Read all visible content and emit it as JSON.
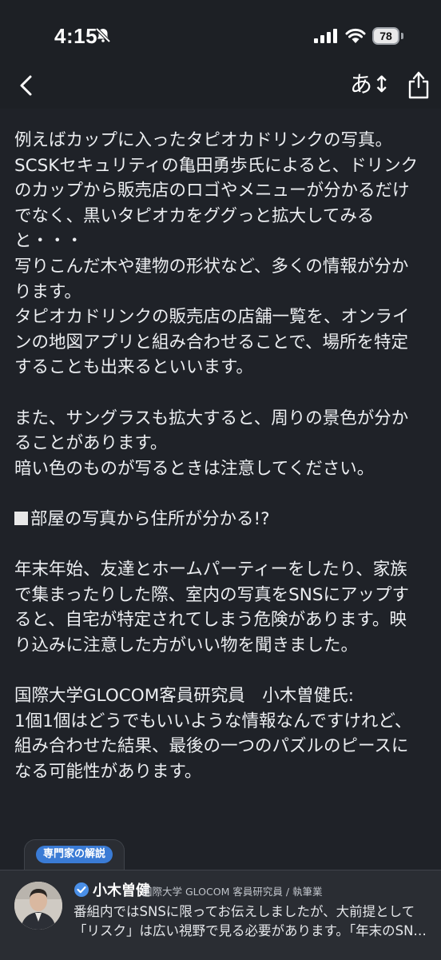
{
  "status_bar": {
    "time": "4:15",
    "battery": "78",
    "icons": [
      "bell-slash-icon",
      "signal-icon",
      "wifi-icon",
      "battery-icon"
    ]
  },
  "nav": {
    "back_icon": "chevron-left-icon",
    "text_size_label": "あ↕",
    "share_icon": "share-icon"
  },
  "article": {
    "lines": [
      "例えばカップに入ったタピオカドリンクの写真。",
      "SCSKセキュリティの亀田勇歩氏によると、ドリンク",
      "のカップから販売店のロゴやメニューが分かるだけ",
      "でなく、黒いタピオカをググっと拡大してみる",
      "と・・・",
      "写りこんだ木や建物の形状など、多くの情報が分か",
      "ります。",
      "タピオカドリンクの販売店の店舗一覧を、オンライ",
      "ンの地図アプリと組み合わせることで、場所を特定",
      "することも出来るといいます。",
      "",
      "また、サングラスも拡大すると、周りの景色が分か",
      "ることがあります。",
      "暗い色のものが写るときは注意してください。",
      "",
      "部屋の写真から住所が分かる!?",
      "",
      "年末年始、友達とホームパーティーをしたり、家族",
      "で集まったりした際、室内の写真をSNSにアップす",
      "ると、自宅が特定されてしまう危険があります。映",
      "り込みに注意した方がいい物を聞きました。",
      "",
      "国際大学GLOCOM客員研究員　小木曽健氏:",
      "1個1個はどうでもいいような情報なんですけれど、",
      "組み合わせた結果、最後の一つのパズルのピースに",
      "なる可能性があります。"
    ]
  },
  "expert": {
    "tab_label": "専門家の解説",
    "name": "小木曽健",
    "role": "国際大学 GLOCOM 客員研究員 / 執筆業",
    "comment_line1": "番組内ではSNSに限ってお伝えしましたが、大前提として",
    "comment_line2": "「リスク」は広い視野で見る必要があります。「年末のSN…"
  }
}
